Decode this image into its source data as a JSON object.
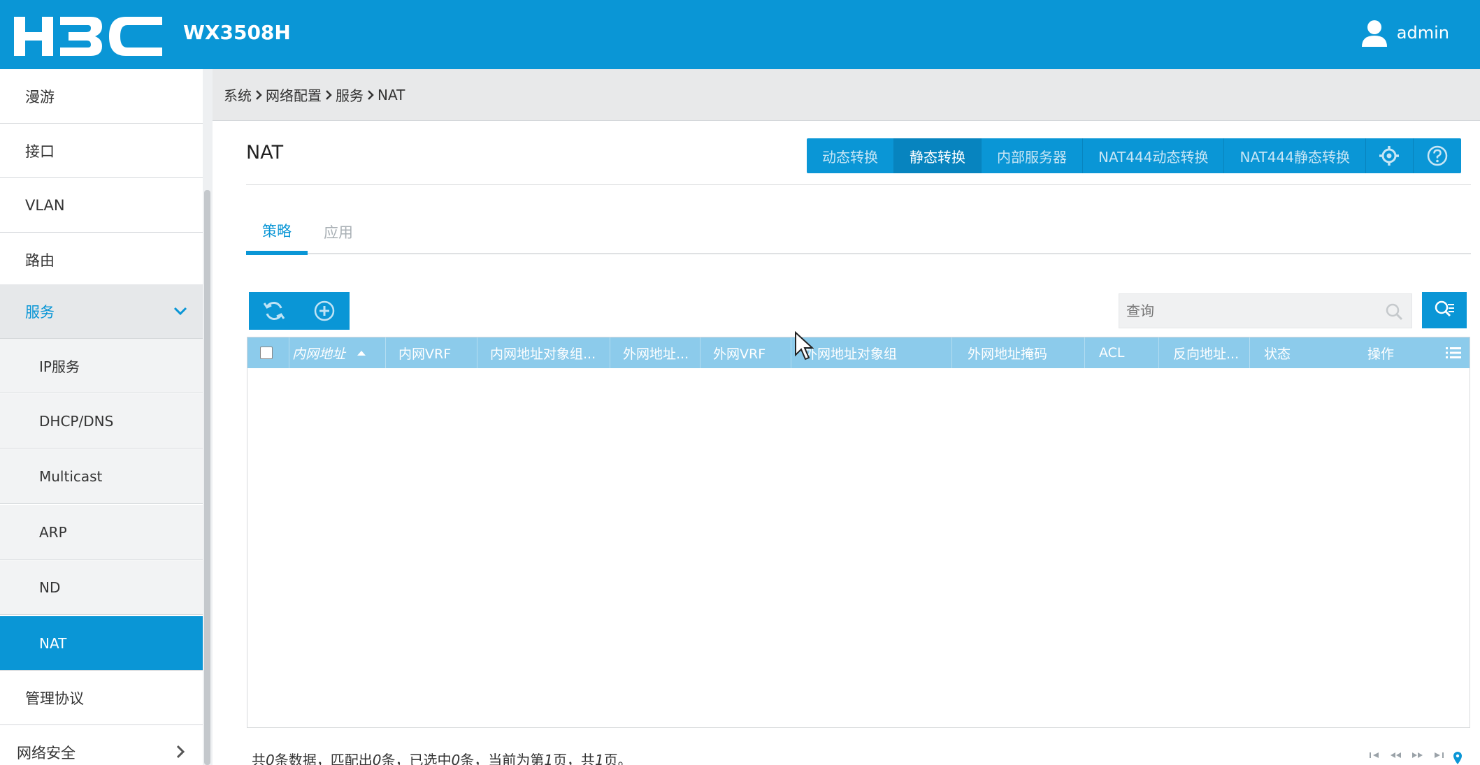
{
  "header": {
    "brand": "H3C",
    "model": "WX3508H",
    "user": "admin"
  },
  "sidebar": {
    "items": [
      {
        "label": "漫游"
      },
      {
        "label": "接口"
      },
      {
        "label": "VLAN"
      },
      {
        "label": "路由"
      },
      {
        "label": "服务"
      },
      {
        "label": "IP服务"
      },
      {
        "label": "DHCP/DNS"
      },
      {
        "label": "Multicast"
      },
      {
        "label": "ARP"
      },
      {
        "label": "ND"
      },
      {
        "label": "NAT"
      },
      {
        "label": "管理协议"
      },
      {
        "label": "网络安全"
      }
    ]
  },
  "breadcrumb": [
    "系统",
    "网络配置",
    "服务",
    "NAT"
  ],
  "page": {
    "title": "NAT",
    "top_buttons": [
      "动态转换",
      "静态转换",
      "内部服务器",
      "NAT444动态转换",
      "NAT444静态转换"
    ],
    "selected_button": "静态转换",
    "tabs": [
      "策略",
      "应用"
    ],
    "active_tab": "策略"
  },
  "search": {
    "placeholder": "查询"
  },
  "table": {
    "columns": [
      "内网地址",
      "内网VRF",
      "内网地址对象组...",
      "外网地址...",
      "外网VRF",
      "外网地址对象组",
      "外网地址掩码",
      "ACL",
      "反向地址...",
      "状态",
      "操作"
    ],
    "rows": []
  },
  "footer": {
    "p1": "共",
    "total": "0",
    "p2": "条数据，匹配出",
    "matched": "0",
    "p3": "条，已选中",
    "selected": "0",
    "p4": "条，当前为第",
    "page": "1",
    "p5": "页，共",
    "pages": "1",
    "p6": "页。"
  },
  "colors": {
    "primary": "#0a96d6",
    "table_header": "#8ccbeb"
  }
}
